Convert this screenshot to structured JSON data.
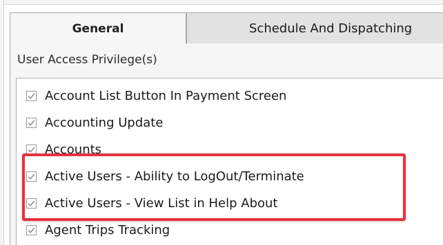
{
  "tabs": [
    {
      "label": "General",
      "active": true
    },
    {
      "label": "Schedule And Dispatching",
      "active": false
    }
  ],
  "group": {
    "label": "User Access Privilege(s)"
  },
  "privileges": [
    {
      "label": "Account List Button In Payment Screen",
      "checked": true
    },
    {
      "label": "Accounting Update",
      "checked": true
    },
    {
      "label": "Accounts",
      "checked": true
    },
    {
      "label": "Active Users - Ability to LogOut/Terminate",
      "checked": true
    },
    {
      "label": "Active Users - View List in Help About",
      "checked": true
    },
    {
      "label": "Agent Trips Tracking",
      "checked": true
    }
  ],
  "colors": {
    "highlight": "#e8313f",
    "check": "#8a8a8a",
    "active_tab": "#f6f6f6",
    "inactive_tab": "#e2e2e2"
  }
}
